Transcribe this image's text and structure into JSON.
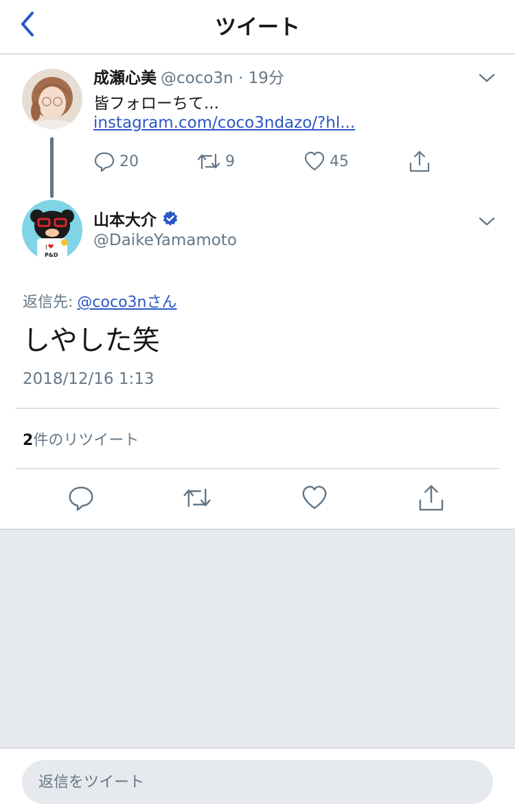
{
  "colors": {
    "accent": "#2b56c5",
    "secondary_text": "#657786",
    "primary_text": "#14171a",
    "background_gray": "#e6e9ed"
  },
  "header": {
    "title": "ツイート",
    "back_icon": "chevron-left-icon"
  },
  "parent_tweet": {
    "display_name": "成瀬心美",
    "handle_time": "@coco3n · 19分",
    "text": "皆フォローちて...",
    "link": "instagram.com/coco3ndazo/?hl...",
    "actions": {
      "reply_count": "20",
      "retweet_count": "9",
      "like_count": "45"
    }
  },
  "tweet": {
    "display_name": "山本大介",
    "verified": true,
    "handle": "@DaikeYamamoto",
    "reply_to_label": "返信先:",
    "reply_to_mention": "@coco3nさん",
    "text": "しやした笑",
    "timestamp": "2018/12/16 1:13",
    "retweet_number": "2",
    "retweet_label": "件のリツイート"
  },
  "reply_bar": {
    "placeholder": "返信をツイート"
  }
}
